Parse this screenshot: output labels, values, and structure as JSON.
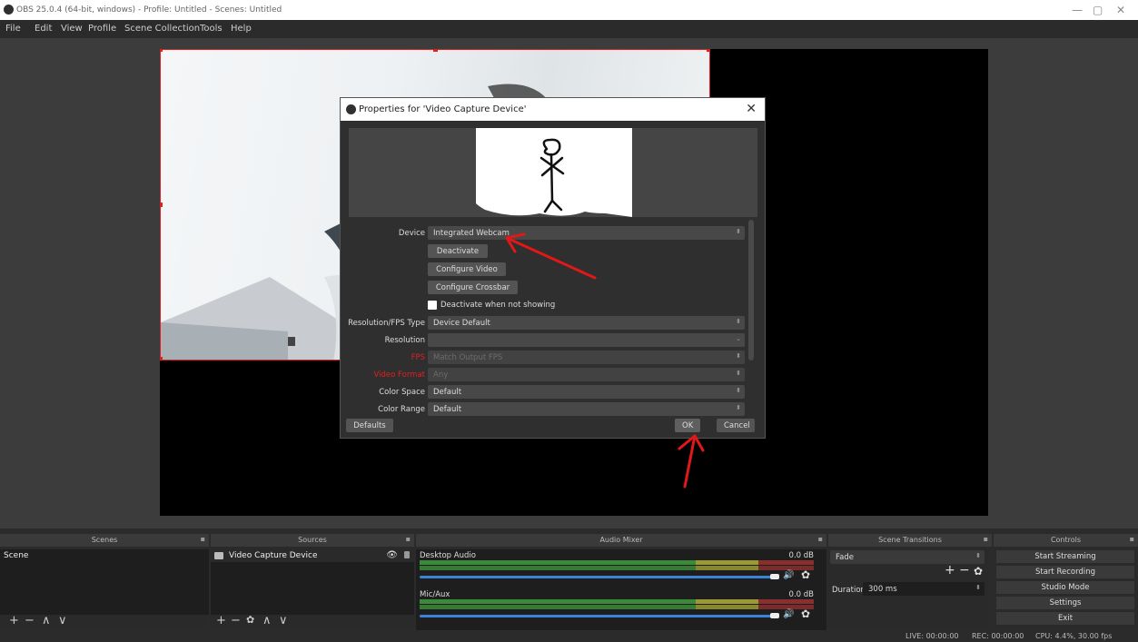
{
  "window": {
    "title": "OBS 25.0.4 (64-bit, windows) - Profile: Untitled - Scenes: Untitled",
    "minimize": "—",
    "restore": "▢",
    "close": "✕"
  },
  "menu": {
    "items": [
      "File",
      "Edit",
      "View",
      "Profile",
      "Scene Collection",
      "Tools",
      "Help"
    ]
  },
  "dialog": {
    "title": "Properties for 'Video Capture Device'",
    "close": "✕",
    "device_label": "Device",
    "device_value": "Integrated Webcam",
    "deactivate_btn": "Deactivate",
    "configure_video_btn": "Configure Video",
    "configure_crossbar_btn": "Configure Crossbar",
    "deactivate_when_not_showing": "Deactivate when not showing",
    "resolution_fps_type_label": "Resolution/FPS Type",
    "resolution_fps_type_value": "Device Default",
    "resolution_label": "Resolution",
    "resolution_value": "",
    "fps_label": "FPS",
    "fps_value": "Match Output FPS",
    "video_format_label": "Video Format",
    "video_format_value": "Any",
    "color_space_label": "Color Space",
    "color_space_value": "Default",
    "color_range_label": "Color Range",
    "color_range_value": "Default",
    "defaults_btn": "Defaults",
    "ok_btn": "OK",
    "cancel_btn": "Cancel"
  },
  "docks": {
    "scenes": {
      "title": "Scenes",
      "items": [
        "Scene"
      ]
    },
    "sources": {
      "title": "Sources",
      "items": [
        "Video Capture Device"
      ]
    },
    "mixer": {
      "title": "Audio Mixer",
      "channels": [
        {
          "name": "Desktop Audio",
          "db": "0.0 dB"
        },
        {
          "name": "Mic/Aux",
          "db": "0.0 dB"
        }
      ]
    },
    "transitions": {
      "title": "Scene Transitions",
      "transition": "Fade",
      "duration_label": "Duration",
      "duration_value": "300 ms"
    },
    "controls": {
      "title": "Controls",
      "buttons": [
        "Start Streaming",
        "Start Recording",
        "Studio Mode",
        "Settings",
        "Exit"
      ]
    }
  },
  "status": {
    "live": "LIVE: 00:00:00",
    "rec": "REC: 00:00:00",
    "cpu": "CPU: 4.4%, 30.00 fps"
  },
  "colors": {
    "accent_red": "#e02020",
    "meter_green": "#3a8a3a",
    "volume_blue": "#3c82d6"
  }
}
